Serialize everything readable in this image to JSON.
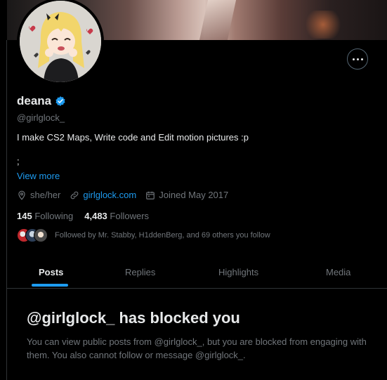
{
  "profile": {
    "name": "deana",
    "handle": "@girlglock_",
    "bio": "I make CS2 Maps, Write code and Edit motion pictures :p",
    "bio_line2": ";",
    "view_more": "View more",
    "pronouns": "she/her",
    "website": "girlglock.com",
    "joined": "Joined May 2017"
  },
  "stats": {
    "following_count": "145",
    "following_label": "Following",
    "followers_count": "4,483",
    "followers_label": "Followers"
  },
  "followed_by": "Followed by Mr. Stabby, H1ddenBerg, and 69 others you follow",
  "tabs": [
    {
      "label": "Posts"
    },
    {
      "label": "Replies"
    },
    {
      "label": "Highlights"
    },
    {
      "label": "Media"
    }
  ],
  "blocked": {
    "title": "@girlglock_ has blocked you",
    "description": "You can view public posts from @girlglock_, but you are blocked from engaging with them. You also cannot follow or message @girlglock_."
  },
  "colors": {
    "background": "#000000",
    "accent": "#1d9bf0",
    "muted": "#71767b",
    "text": "#e7e9ea"
  },
  "icons": [
    "verified-badge-icon",
    "location-icon",
    "link-icon",
    "calendar-icon",
    "more-icon"
  ]
}
